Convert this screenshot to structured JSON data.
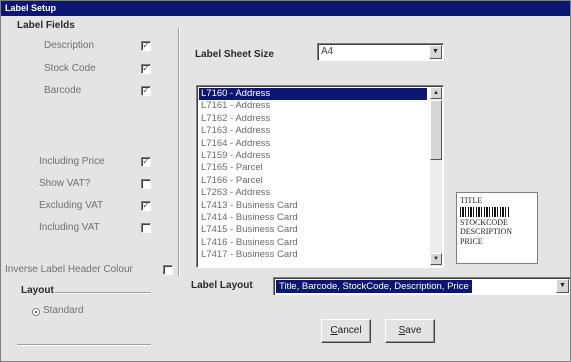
{
  "window": {
    "title": "Label Setup"
  },
  "label_fields": {
    "heading": "Label Fields",
    "fields": [
      {
        "label": "Description",
        "checked": true
      },
      {
        "label": "Stock Code",
        "checked": true
      },
      {
        "label": "Barcode",
        "checked": true
      }
    ],
    "price_fields": [
      {
        "label": "Including Price",
        "checked": true
      },
      {
        "label": "Show VAT?",
        "checked": false
      },
      {
        "label": "Excluding VAT",
        "checked": true
      },
      {
        "label": "Including VAT",
        "checked": false
      }
    ],
    "inverse_header": {
      "label": "Inverse Label Header Colour",
      "checked": false
    }
  },
  "layout_group": {
    "heading": "Layout",
    "option": "Standard"
  },
  "sheet_size": {
    "label": "Label Sheet Size",
    "value": "A4"
  },
  "label_list": {
    "items": [
      "L7160 - Address",
      "L7161 - Address",
      "L7162 - Address",
      "L7163 - Address",
      "L7164 - Address",
      "L7159 - Address",
      "L7165 - Parcel",
      "L7166 - Parcel",
      "L7263 - Address",
      "L7413 - Business Card",
      "L7414 - Business Card",
      "L7415 - Business Card",
      "L7416 - Business Card",
      "L7417 - Business Card"
    ],
    "selected_index": 0
  },
  "preview": {
    "title": "TITLE",
    "stockcode": "STOCKCODE",
    "description": "DESCRIPTION",
    "price": "PRICE"
  },
  "label_layout": {
    "label": "Label Layout",
    "value": "Title, Barcode, StockCode, Description, Price"
  },
  "buttons": {
    "cancel": {
      "accel": "C",
      "rest": "ancel"
    },
    "save": {
      "accel": "S",
      "rest": "ave"
    }
  },
  "colors": {
    "title_bar": "#0a1670",
    "selection": "#0a1670",
    "dialog_bg": "#e4e4e4"
  },
  "icons": {
    "checkmark": "check-icon",
    "dropdown": "dropdown-arrow-icon",
    "scroll_up": "scroll-up-icon",
    "scroll_down": "scroll-down-icon",
    "radio": "radio-selected-icon"
  }
}
